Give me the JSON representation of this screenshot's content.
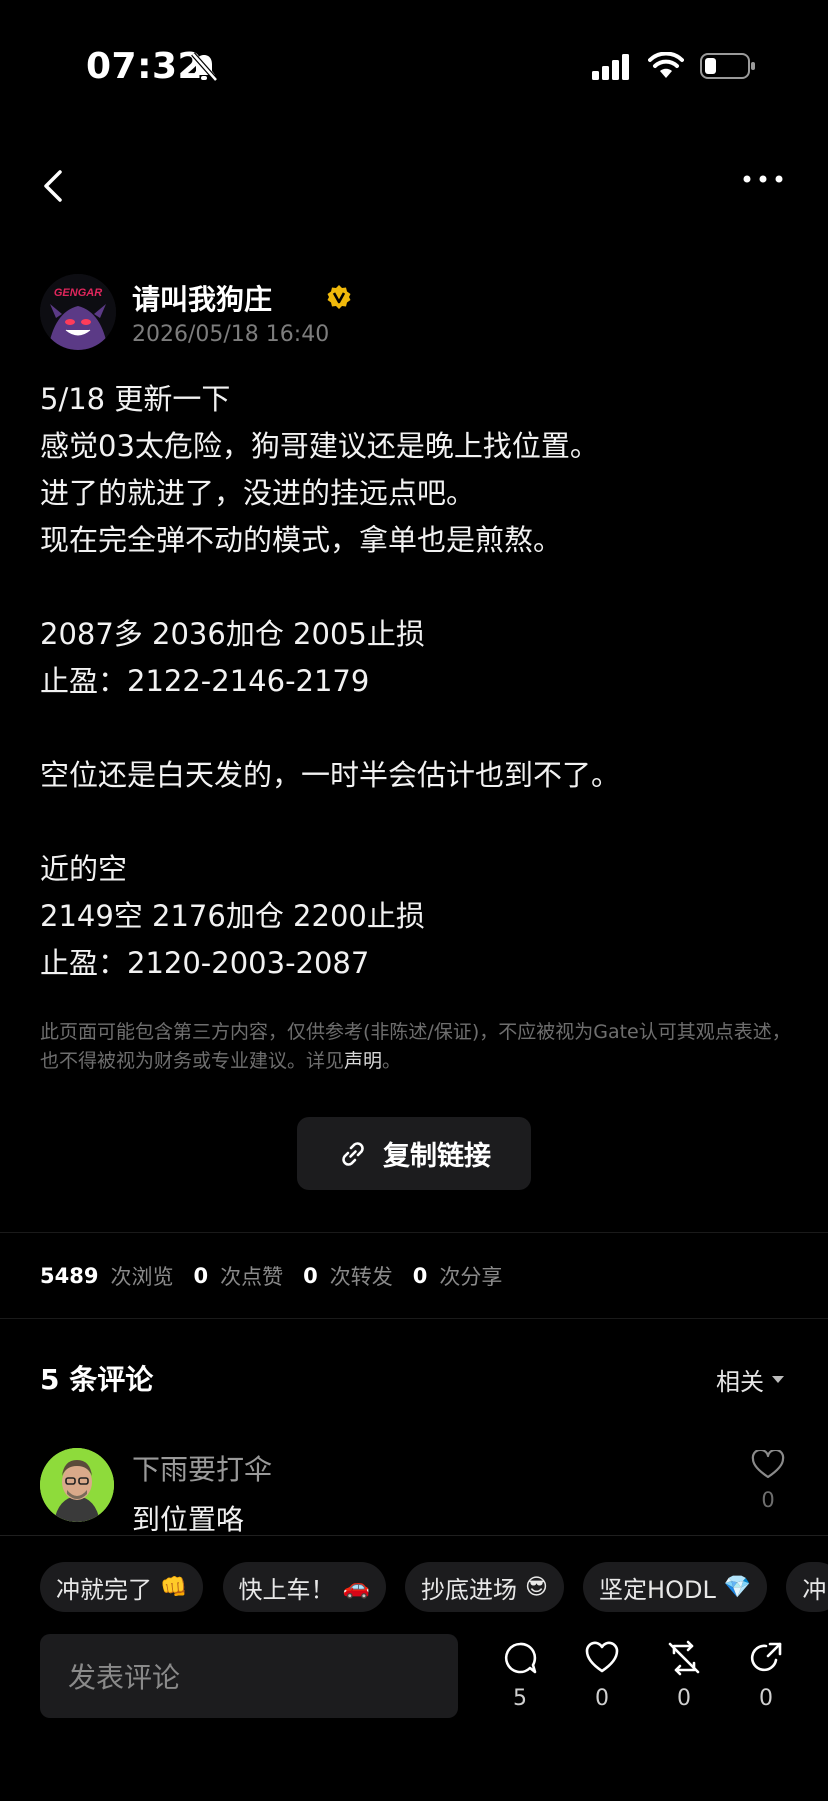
{
  "status_bar": {
    "time": "07:32"
  },
  "author": {
    "name": "请叫我狗庄",
    "date": "2026/05/18 16:40",
    "avatar_text": "GENGAR"
  },
  "post": {
    "lines": [
      "5/18  更新一下",
      "感觉03太危险，狗哥建议还是晚上找位置。",
      "进了的就进了，没进的挂远点吧。",
      "现在完全弹不动的模式，拿单也是煎熬。",
      "",
      "2087多 2036加仓 2005止损",
      "止盈：2122-2146-2179",
      "",
      "空位还是白天发的，一时半会估计也到不了。",
      "",
      "近的空",
      "2149空  2176加仓 2200止损",
      "止盈：2120-2003-2087"
    ]
  },
  "disclaimer": {
    "text": "此页面可能包含第三方内容，仅供参考(非陈述/保证)，不应被视为Gate认可其观点表述，也不得被视为财务或专业建议。详见",
    "link": "声明",
    "end": "。"
  },
  "copy_link": {
    "label": "复制链接"
  },
  "stats": [
    {
      "value": "5489",
      "label": "次浏览"
    },
    {
      "value": "0",
      "label": "次点赞"
    },
    {
      "value": "0",
      "label": "次转发"
    },
    {
      "value": "0",
      "label": "次分享"
    }
  ],
  "comments": {
    "title": "5 条评论",
    "sort_label": "相关",
    "items": [
      {
        "name": "下雨要打伞",
        "text": "到位置咯",
        "likes": "0"
      }
    ]
  },
  "quick_replies": [
    {
      "text": "冲就完了",
      "emoji": "👊"
    },
    {
      "text": "快上车！",
      "emoji": "🚗"
    },
    {
      "text": "抄底进场",
      "emoji": "😎"
    },
    {
      "text": "坚定HODL",
      "emoji": "💎"
    },
    {
      "text": "冲",
      "emoji": ""
    }
  ],
  "comment_input": {
    "placeholder": "发表评论"
  },
  "actions": {
    "comment_count": "5",
    "like_count": "0",
    "repost_count": "0",
    "share_count": "0"
  },
  "colors": {
    "background": "#000000",
    "verified_badge": "#f0b90b",
    "chip_bg": "#1c1c1e"
  }
}
